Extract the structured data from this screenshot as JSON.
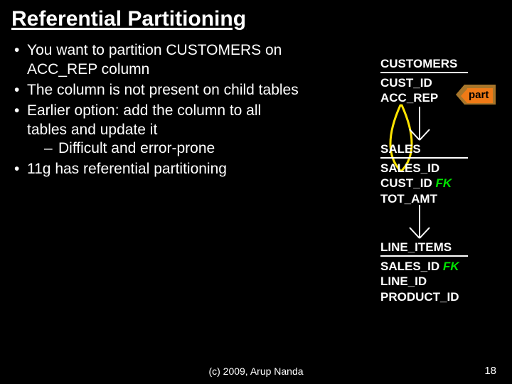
{
  "title": "Referential Partitioning",
  "bullets": {
    "b1": "You want to partition CUSTOMERS on ACC_REP column",
    "b2": "The column is not present on child tables",
    "b3": "Earlier option: add the column to all tables and update it",
    "b3s": "Difficult and error-prone",
    "b4": "11g has referential partitioning"
  },
  "part_label": "part",
  "tables": {
    "customers": {
      "name": "CUSTOMERS",
      "c1": "CUST_ID",
      "c2": "ACC_REP"
    },
    "sales": {
      "name": "SALES",
      "c1": "SALES_ID",
      "c2": "CUST_ID ",
      "c2fk": "FK",
      "c3": "TOT_AMT"
    },
    "line_items": {
      "name": "LINE_ITEMS",
      "c1": "SALES_ID ",
      "c1fk": "FK",
      "c2": "LINE_ID",
      "c3": "PRODUCT_ID"
    }
  },
  "footer": "(c) 2009, Arup Nanda",
  "page": "18"
}
